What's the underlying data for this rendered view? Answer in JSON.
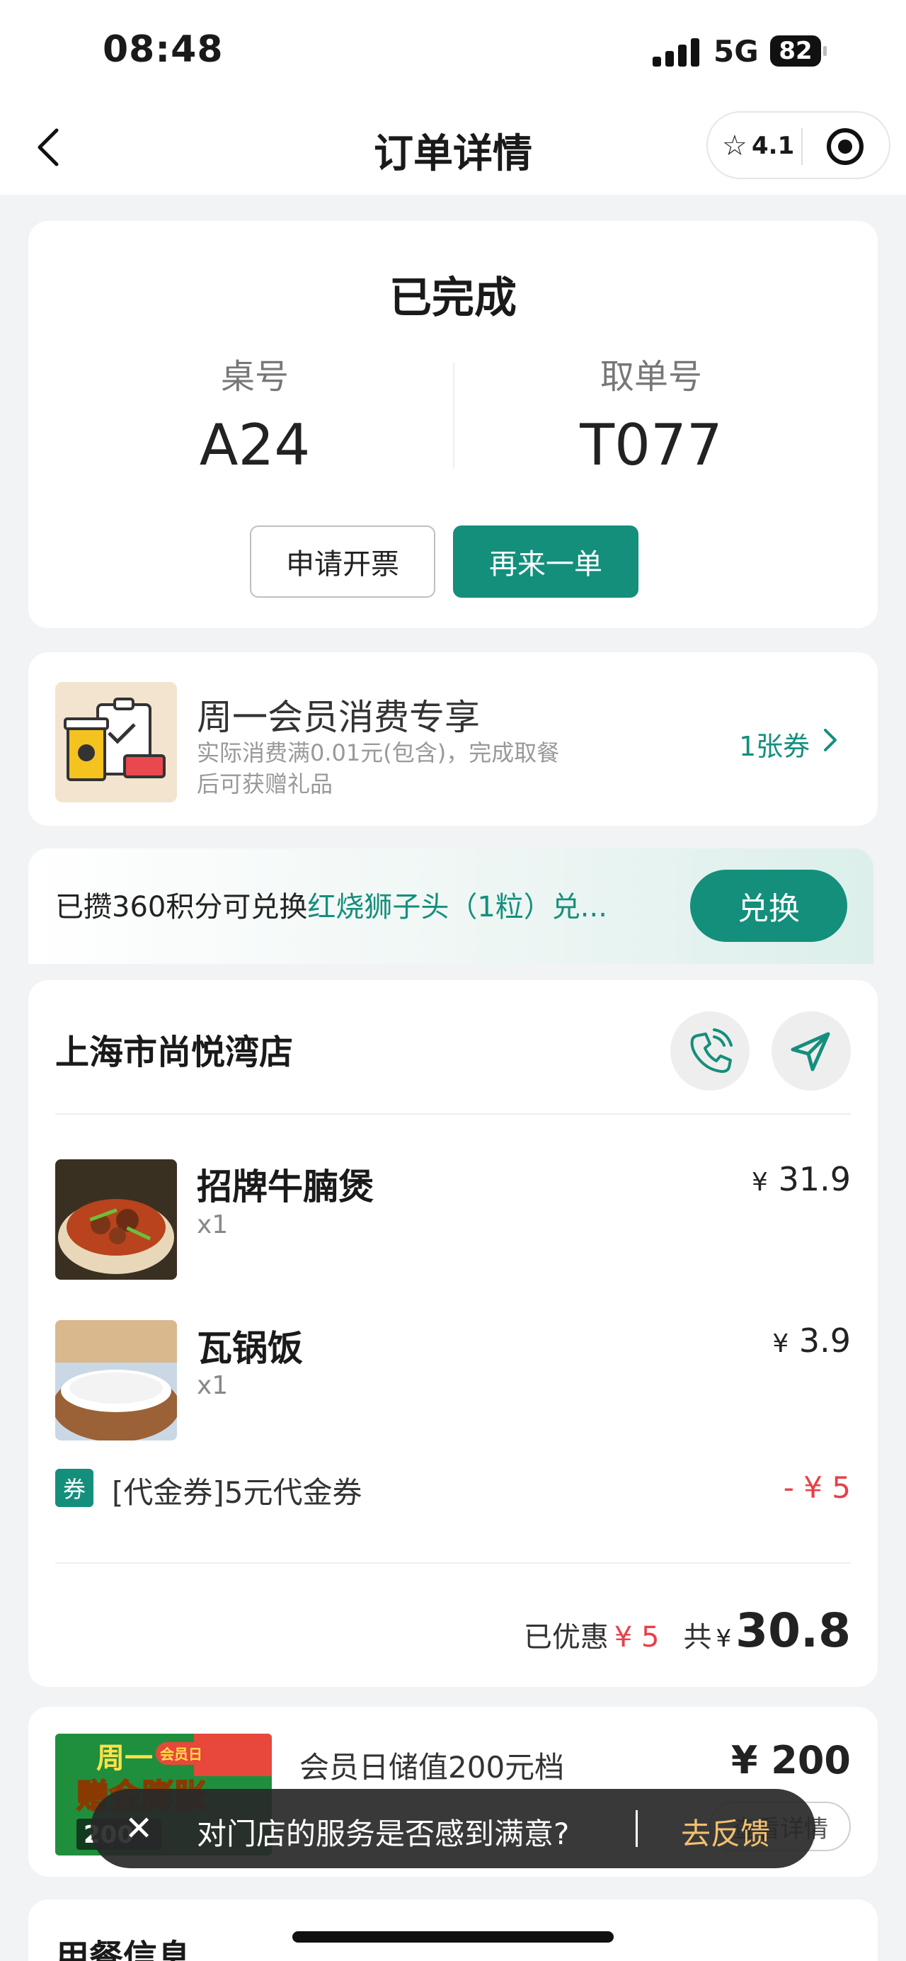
{
  "status_bar": {
    "time": "08:48",
    "network": "5G",
    "battery": "82"
  },
  "nav": {
    "title": "订单详情",
    "rating": "4.1"
  },
  "order_status": {
    "title": "已完成",
    "table_label": "桌号",
    "table_value": "A24",
    "pickup_label": "取单号",
    "pickup_value": "T077",
    "invoice_button": "申请开票",
    "reorder_button": "再来一单"
  },
  "member_promo": {
    "title": "周一会员消费专享",
    "desc": "实际消费满0.01元(包含)，完成取餐后可获赠礼品",
    "coupon_count": "1张券"
  },
  "points": {
    "prefix": "已攒360积分可兑换",
    "highlight": "红烧狮子头（1粒）兑...",
    "button": "兑换"
  },
  "order": {
    "store_name": "上海市尚悦湾店",
    "items": [
      {
        "name": "招牌牛腩煲",
        "qty": "x1",
        "currency": "¥",
        "price": "31.9"
      },
      {
        "name": "瓦锅饭",
        "qty": "x1",
        "currency": "¥",
        "price": "3.9"
      }
    ],
    "coupon": {
      "tag": "券",
      "name": "[代金券]5元代金券",
      "amount": "- ¥ 5"
    },
    "summary": {
      "discount_label": "已优惠",
      "discount_value": "¥ 5",
      "total_label": "共",
      "currency": "¥",
      "total_value": "30.8"
    }
  },
  "recharge": {
    "title": "会员日储值200元档",
    "price": "¥ 200",
    "button": "查看详情",
    "img_line1": "周一",
    "img_badge": "会员日",
    "img_line2": "赠金膨胀",
    "img_amount": "200"
  },
  "dining_info": {
    "title": "用餐信息"
  },
  "toast": {
    "close": "✕",
    "message": "对门店的服务是否感到满意?",
    "action": "去反馈"
  },
  "colors": {
    "brand": "#148f7c",
    "discount": "#e8404a",
    "toast_action": "#f3c070"
  }
}
